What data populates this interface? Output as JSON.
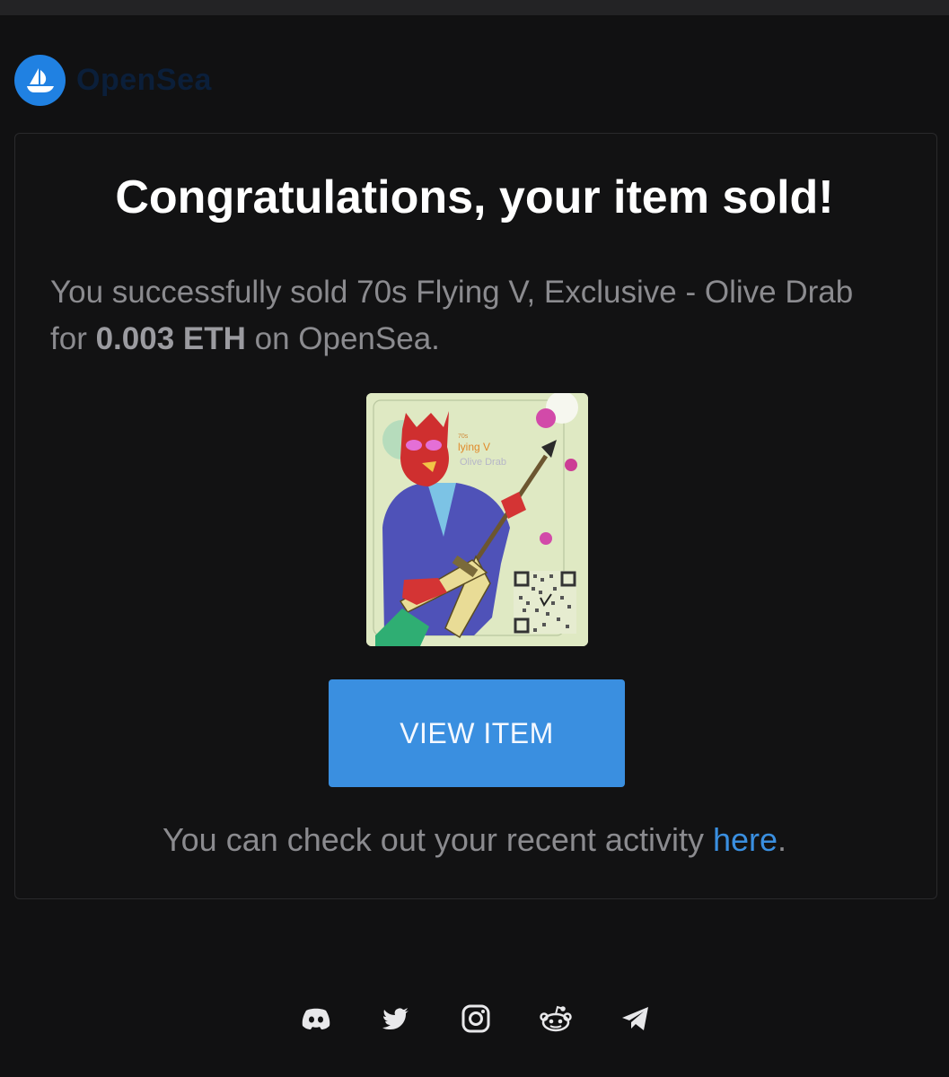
{
  "brand": {
    "name": "OpenSea",
    "logo_icon": "opensea-ship-icon",
    "accent_color": "#2081e2"
  },
  "email": {
    "headline": "Congratulations, your item sold!",
    "message_prefix": "You successfully sold 70s Flying V, Exclusive - Olive Drab for ",
    "price": "0.003 ETH",
    "message_suffix": " on OpenSea.",
    "nft_image": {
      "caption_line1": "lying V",
      "caption_line2": "Olive Drab",
      "caption_top": "70s"
    },
    "button_label": "VIEW ITEM",
    "activity_prefix": "You can check out your recent activity ",
    "activity_link": "here",
    "activity_suffix": ".",
    "button_color": "#3a8fe0"
  },
  "footer": {
    "social_icons": [
      "discord-icon",
      "twitter-icon",
      "instagram-icon",
      "reddit-icon",
      "telegram-icon"
    ]
  }
}
